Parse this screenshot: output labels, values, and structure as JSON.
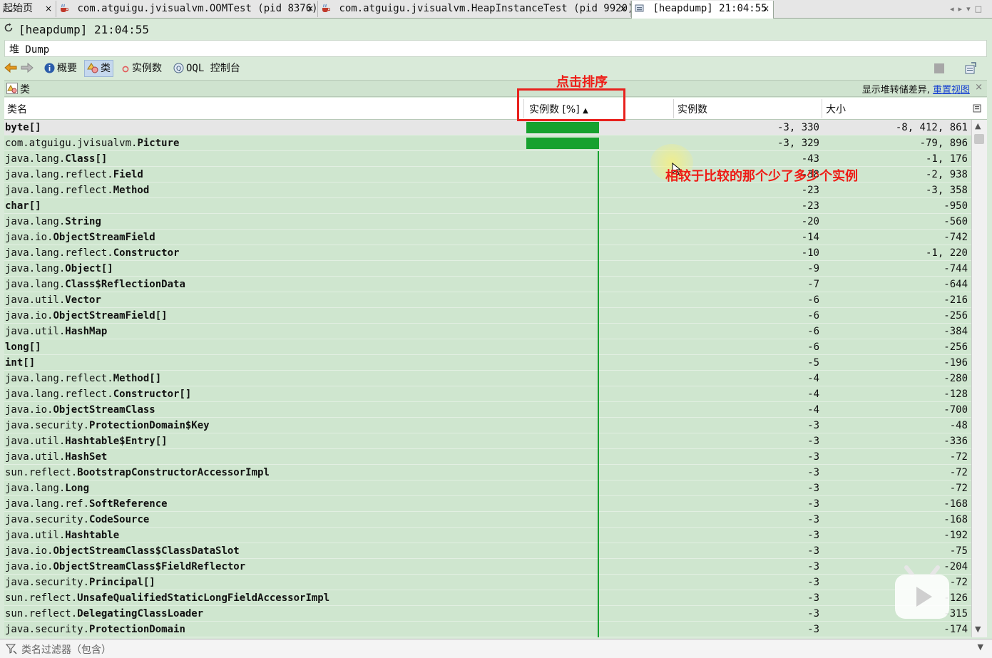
{
  "tabs": [
    {
      "label": "起始页",
      "close": "×",
      "icon": ""
    },
    {
      "label": "com.atguigu.jvisualvm.OOMTest (pid 8376)",
      "close": "×",
      "icon": "java-cup-icon"
    },
    {
      "label": "com.atguigu.jvisualvm.HeapInstanceTest (pid 9920)",
      "close": "×",
      "icon": "java-cup-icon"
    },
    {
      "label": "[heapdump] 21:04:55",
      "close": "×",
      "icon": "heapdump-icon"
    }
  ],
  "window_title": "[heapdump] 21:04:55",
  "subtitle": "堆 Dump",
  "toolbar": {
    "summary": "概要",
    "classes": "类",
    "instances": "实例数",
    "oql": "OQL 控制台"
  },
  "panel": {
    "title": "类",
    "diff_text": "显示堆转储差异, ",
    "reset_link": "重置视图",
    "close": "×"
  },
  "columns": {
    "name": "类名",
    "instances_pct": "实例数 [%]",
    "instances": "实例数",
    "size": "大小"
  },
  "rows": [
    {
      "pkg": "",
      "cls": "byte[]",
      "bar": 1.0,
      "instances": "-3, 330",
      "size": "-8, 412, 861"
    },
    {
      "pkg": "com.atguigu.jvisualvm.",
      "cls": "Picture",
      "bar": 1.0,
      "instances": "-3, 329",
      "size": "-79, 896"
    },
    {
      "pkg": "java.lang.",
      "cls": "Class[]",
      "bar": 0,
      "instances": "-43",
      "size": "-1, 176"
    },
    {
      "pkg": "java.lang.reflect.",
      "cls": "Field",
      "bar": 0,
      "instances": "-38",
      "size": "-2, 938"
    },
    {
      "pkg": "java.lang.reflect.",
      "cls": "Method",
      "bar": 0,
      "instances": "-23",
      "size": "-3, 358"
    },
    {
      "pkg": "",
      "cls": "char[]",
      "bar": 0,
      "instances": "-23",
      "size": "-950"
    },
    {
      "pkg": "java.lang.",
      "cls": "String",
      "bar": 0,
      "instances": "-20",
      "size": "-560"
    },
    {
      "pkg": "java.io.",
      "cls": "ObjectStreamField",
      "bar": 0,
      "instances": "-14",
      "size": "-742"
    },
    {
      "pkg": "java.lang.reflect.",
      "cls": "Constructor",
      "bar": 0,
      "instances": "-10",
      "size": "-1, 220"
    },
    {
      "pkg": "java.lang.",
      "cls": "Object[]",
      "bar": 0,
      "instances": "-9",
      "size": "-744"
    },
    {
      "pkg": "java.lang.",
      "cls": "Class$ReflectionData",
      "bar": 0,
      "instances": "-7",
      "size": "-644"
    },
    {
      "pkg": "java.util.",
      "cls": "Vector",
      "bar": 0,
      "instances": "-6",
      "size": "-216"
    },
    {
      "pkg": "java.io.",
      "cls": "ObjectStreamField[]",
      "bar": 0,
      "instances": "-6",
      "size": "-256"
    },
    {
      "pkg": "java.util.",
      "cls": "HashMap",
      "bar": 0,
      "instances": "-6",
      "size": "-384"
    },
    {
      "pkg": "",
      "cls": "long[]",
      "bar": 0,
      "instances": "-6",
      "size": "-256"
    },
    {
      "pkg": "",
      "cls": "int[]",
      "bar": 0,
      "instances": "-5",
      "size": "-196"
    },
    {
      "pkg": "java.lang.reflect.",
      "cls": "Method[]",
      "bar": 0,
      "instances": "-4",
      "size": "-280"
    },
    {
      "pkg": "java.lang.reflect.",
      "cls": "Constructor[]",
      "bar": 0,
      "instances": "-4",
      "size": "-128"
    },
    {
      "pkg": "java.io.",
      "cls": "ObjectStreamClass",
      "bar": 0,
      "instances": "-4",
      "size": "-700"
    },
    {
      "pkg": "java.security.",
      "cls": "ProtectionDomain$Key",
      "bar": 0,
      "instances": "-3",
      "size": "-48"
    },
    {
      "pkg": "java.util.",
      "cls": "Hashtable$Entry[]",
      "bar": 0,
      "instances": "-3",
      "size": "-336"
    },
    {
      "pkg": "java.util.",
      "cls": "HashSet",
      "bar": 0,
      "instances": "-3",
      "size": "-72"
    },
    {
      "pkg": "sun.reflect.",
      "cls": "BootstrapConstructorAccessorImpl",
      "bar": 0,
      "instances": "-3",
      "size": "-72"
    },
    {
      "pkg": "java.lang.",
      "cls": "Long",
      "bar": 0,
      "instances": "-3",
      "size": "-72"
    },
    {
      "pkg": "java.lang.ref.",
      "cls": "SoftReference",
      "bar": 0,
      "instances": "-3",
      "size": "-168"
    },
    {
      "pkg": "java.security.",
      "cls": "CodeSource",
      "bar": 0,
      "instances": "-3",
      "size": "-168"
    },
    {
      "pkg": "java.util.",
      "cls": "Hashtable",
      "bar": 0,
      "instances": "-3",
      "size": "-192"
    },
    {
      "pkg": "java.io.",
      "cls": "ObjectStreamClass$ClassDataSlot",
      "bar": 0,
      "instances": "-3",
      "size": "-75"
    },
    {
      "pkg": "java.io.",
      "cls": "ObjectStreamClass$FieldReflector",
      "bar": 0,
      "instances": "-3",
      "size": "-204"
    },
    {
      "pkg": "java.security.",
      "cls": "Principal[]",
      "bar": 0,
      "instances": "-3",
      "size": "-72"
    },
    {
      "pkg": "sun.reflect.",
      "cls": "UnsafeQualifiedStaticLongFieldAccessorImpl",
      "bar": 0,
      "instances": "-3",
      "size": "-126"
    },
    {
      "pkg": "sun.reflect.",
      "cls": "DelegatingClassLoader",
      "bar": 0,
      "instances": "-3",
      "size": "-315"
    },
    {
      "pkg": "java.security.",
      "cls": "ProtectionDomain",
      "bar": 0,
      "instances": "-3",
      "size": "-174"
    }
  ],
  "filter_placeholder": "类名过滤器（包含）",
  "annotations": {
    "sort_hint": "点击排序",
    "diff_hint": "相较于比较的那个少了多少个实例"
  },
  "colors": {
    "accent_green": "#16a12e",
    "row_bg": "#cfe6cf",
    "annotation_red": "#ee1c16",
    "link_blue": "#1a44d0"
  }
}
